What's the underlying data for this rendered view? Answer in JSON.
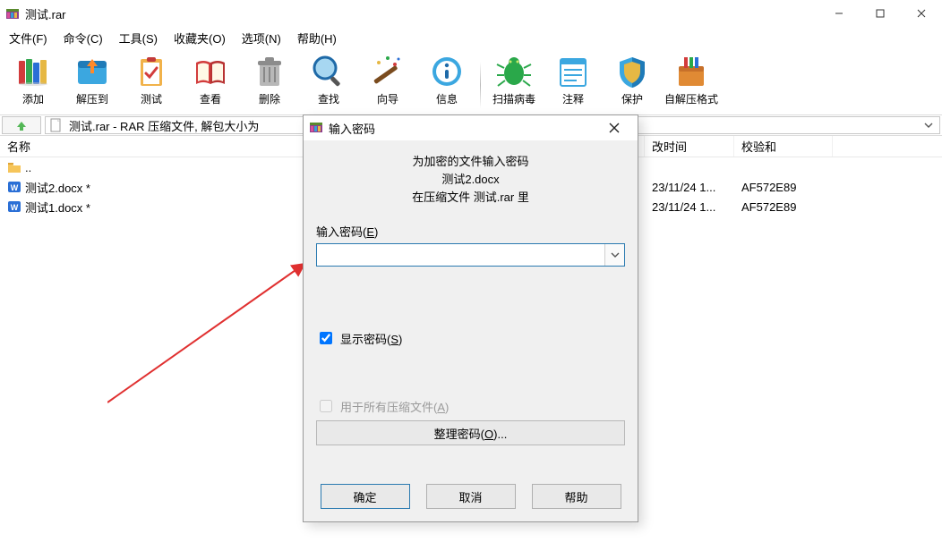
{
  "window": {
    "title": "测试.rar"
  },
  "menubar": [
    "文件(F)",
    "命令(C)",
    "工具(S)",
    "收藏夹(O)",
    "选项(N)",
    "帮助(H)"
  ],
  "toolbar": [
    {
      "id": "add",
      "label": "添加"
    },
    {
      "id": "extract",
      "label": "解压到"
    },
    {
      "id": "test",
      "label": "测试"
    },
    {
      "id": "view",
      "label": "查看"
    },
    {
      "id": "delete",
      "label": "删除"
    },
    {
      "id": "find",
      "label": "查找"
    },
    {
      "id": "wizard",
      "label": "向导"
    },
    {
      "id": "info",
      "label": "信息"
    },
    {
      "id": "sep",
      "label": ""
    },
    {
      "id": "virus",
      "label": "扫描病毒"
    },
    {
      "id": "comment",
      "label": "注释"
    },
    {
      "id": "protect",
      "label": "保护"
    },
    {
      "id": "sfx",
      "label": "自解压格式"
    }
  ],
  "address": "测试.rar - RAR 压缩文件, 解包大小为",
  "columns": {
    "name": "名称",
    "date": "改时间",
    "crc": "校验和"
  },
  "rows": [
    {
      "name": "..",
      "kind": "folder",
      "date": "",
      "crc": ""
    },
    {
      "name": "测试2.docx *",
      "kind": "docx",
      "date": "23/11/24 1...",
      "crc": "AF572E89"
    },
    {
      "name": "测试1.docx *",
      "kind": "docx",
      "date": "23/11/24 1...",
      "crc": "AF572E89"
    }
  ],
  "dialog": {
    "title": "输入密码",
    "text1": "为加密的文件输入密码",
    "text2": "测试2.docx",
    "text3": "在压缩文件 测试.rar 里",
    "pw_label_pre": "输入密码(",
    "pw_label_u": "E",
    "pw_label_post": ")",
    "pw_value": "",
    "show_pw_pre": "显示密码(",
    "show_pw_u": "S",
    "show_pw_post": ")",
    "show_pw_checked": true,
    "use_all_pre": "用于所有压缩文件(",
    "use_all_u": "A",
    "use_all_post": ")",
    "use_all_checked": false,
    "manage_pre": "整理密码(",
    "manage_u": "O",
    "manage_post": ")...",
    "ok": "确定",
    "cancel": "取消",
    "help": "帮助"
  }
}
